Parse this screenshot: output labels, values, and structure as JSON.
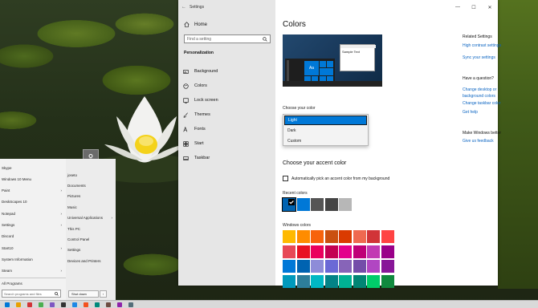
{
  "window": {
    "title": "Settings",
    "controls": {
      "minimize": "—",
      "maximize": "☐",
      "close": "✕"
    }
  },
  "nav": {
    "home": "Home",
    "search_placeholder": "Find a setting",
    "heading": "Personalization",
    "items": [
      {
        "label": "Background",
        "icon": "picture-icon"
      },
      {
        "label": "Colors",
        "icon": "palette-icon"
      },
      {
        "label": "Lock screen",
        "icon": "lock-screen-icon"
      },
      {
        "label": "Themes",
        "icon": "brush-icon"
      },
      {
        "label": "Fonts",
        "icon": "font-icon"
      },
      {
        "label": "Start",
        "icon": "start-icon"
      },
      {
        "label": "Taskbar",
        "icon": "taskbar-icon"
      }
    ]
  },
  "main": {
    "title": "Colors",
    "preview": {
      "tile_text": "Aa",
      "dialog_text": "Sample Text"
    },
    "choose_color_label": "Choose your color",
    "color_options": [
      "Light",
      "Dark",
      "Custom"
    ],
    "selected_color_option": "Light",
    "accent_title": "Choose your accent color",
    "auto_accent_label": "Automatically pick an accent color from my background",
    "recent_colors_label": "Recent colors",
    "recent_colors": [
      "#0063b1",
      "#0078d7",
      "#555555",
      "#444444",
      "#b7b7b7"
    ],
    "windows_colors_label": "Windows colors",
    "windows_colors": [
      [
        "#ffb900",
        "#ff8c00",
        "#f7630c",
        "#ca5010",
        "#da3b01",
        "#ef6950",
        "#d13438",
        "#ff4343"
      ],
      [
        "#e74856",
        "#e81123",
        "#ea005e",
        "#c30052",
        "#e3008c",
        "#bf0077",
        "#c239b3",
        "#9a0089"
      ],
      [
        "#0078d7",
        "#0063b1",
        "#8e8cd8",
        "#6b69d6",
        "#8764b8",
        "#744da9",
        "#b146c2",
        "#881798"
      ],
      [
        "#0099bc",
        "#2d7d9a",
        "#00b7c3",
        "#038387",
        "#00b294",
        "#018574",
        "#00cc6a",
        "#10893e"
      ]
    ]
  },
  "related": {
    "settings_heading": "Related Settings",
    "settings_links": [
      "High contrast settings",
      "Sync your settings"
    ],
    "question_heading": "Have a question?",
    "question_links": [
      "Change desktop or background colors",
      "Change taskbar color",
      "Get help"
    ],
    "better_heading": "Make Windows better",
    "better_links": [
      "Give us feedback"
    ]
  },
  "startmenu": {
    "left_items": [
      {
        "label": "Skype",
        "arrow": ""
      },
      {
        "label": "Windows 10 Menu",
        "arrow": ""
      },
      {
        "label": "Paint",
        "arrow": "›"
      },
      {
        "label": "DeskScapes 10",
        "arrow": ""
      },
      {
        "label": "Notepad",
        "arrow": "›"
      },
      {
        "label": "Settings",
        "arrow": "›"
      },
      {
        "label": "Discord",
        "arrow": ""
      },
      {
        "label": "Start10",
        "arrow": "›"
      },
      {
        "label": "System Information",
        "arrow": ""
      },
      {
        "label": "Steam",
        "arrow": "›"
      }
    ],
    "all_programs": "All Programs",
    "right_items": [
      {
        "label": "joseto",
        "arrow": ""
      },
      {
        "label": "Documents",
        "arrow": ""
      },
      {
        "label": "Pictures",
        "arrow": ""
      },
      {
        "label": "Music",
        "arrow": ""
      },
      {
        "label": "Universal Applications",
        "arrow": "›"
      },
      {
        "label": "This PC",
        "arrow": ""
      },
      {
        "label": "Control Panel",
        "arrow": ""
      },
      {
        "label": "Settings",
        "arrow": ""
      },
      {
        "label": "Devices and Printers",
        "arrow": ""
      }
    ],
    "search_placeholder": "Search programs and files",
    "shutdown": "Shut down",
    "shutdown_arrow": "›"
  },
  "taskbar": {
    "icon_colors": [
      "#0078d7",
      "#e8a000",
      "#d13438",
      "#4caf50",
      "#7e57c2",
      "#333333",
      "#1e88e5",
      "#f4511e",
      "#00897b",
      "#6d4c41",
      "#8e24aa",
      "#546e7a"
    ]
  }
}
